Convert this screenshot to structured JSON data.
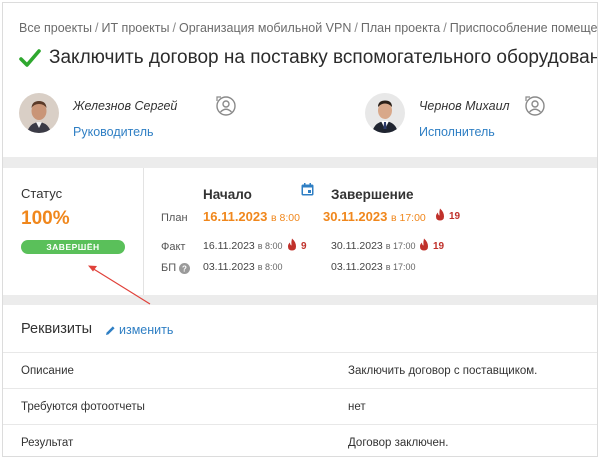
{
  "breadcrumb": {
    "items": [
      "Все проекты",
      "ИТ проекты",
      "Организация мобильной VPN",
      "План проекта",
      "Приспособление помещений"
    ],
    "separator": "/"
  },
  "task": {
    "title": "Заключить договор на поставку вспомогательного оборудования",
    "status_icon": "check-icon"
  },
  "people": {
    "manager": {
      "name": "Железнов Сергей",
      "role": "Руководитель"
    },
    "executor": {
      "name": "Чернов Михаил",
      "role": "Исполнитель"
    }
  },
  "status": {
    "label": "Статус",
    "percent": "100%",
    "badge": "ЗАВЕРШЁН",
    "progress": 1.0
  },
  "schedule": {
    "start_header": "Начало",
    "end_header": "Завершение",
    "rows": {
      "plan": {
        "label": "План",
        "start_date": "16.11.2023",
        "start_time": "в 8:00",
        "end_date": "30.11.2023",
        "end_time": "в 17:00",
        "end_overdue": "19"
      },
      "fact": {
        "label": "Факт",
        "start_date": "16.11.2023",
        "start_time": "в 8:00",
        "start_overdue": "9",
        "end_date": "30.11.2023",
        "end_time": "в 17:00",
        "end_overdue": "19"
      },
      "bp": {
        "label": "БП",
        "start_date": "03.11.2023",
        "start_time": "в 8:00",
        "end_date": "03.11.2023",
        "end_time": "в 17:00"
      }
    }
  },
  "requisites": {
    "title": "Реквизиты",
    "edit_label": "изменить",
    "rows": [
      {
        "key": "Описание",
        "value": "Заключить договор с поставщиком."
      },
      {
        "key": "Требуются фотоотчеты",
        "value": "нет"
      },
      {
        "key": "Результат",
        "value": "Договор заключен."
      }
    ]
  },
  "colors": {
    "accent_orange": "#f0871c",
    "link_blue": "#2f7fc4",
    "success_green": "#5ac05a",
    "check_green": "#2fa82f",
    "fire_red": "#c0312b"
  }
}
